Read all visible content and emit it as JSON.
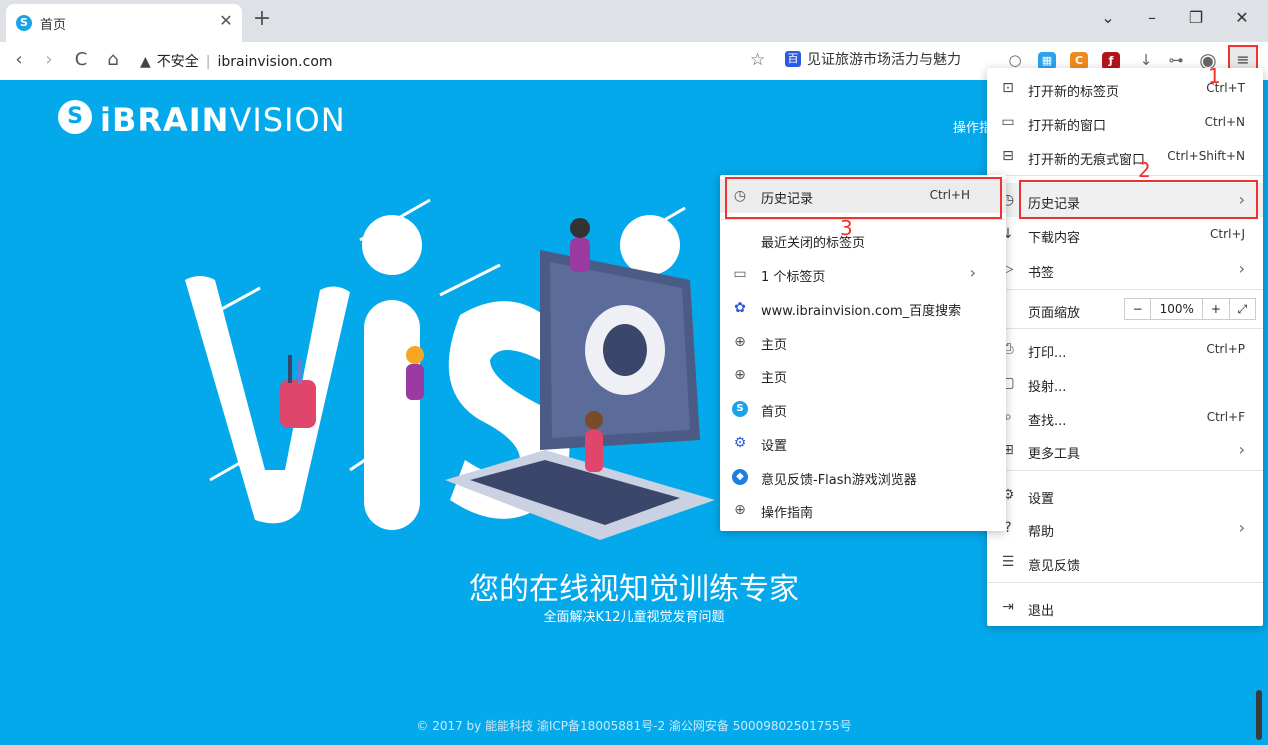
{
  "tab": {
    "title": "首页",
    "favicon": "S"
  },
  "window": {
    "minimize": "–",
    "restore": "❐",
    "close": "✕",
    "dropdown": "⌄",
    "new_tab": "+"
  },
  "toolbar": {
    "back": "‹",
    "forward": "›",
    "reload": "C",
    "home": "⌂",
    "security_label": "不安全",
    "url": "ibrainvision.com",
    "search_text": "见证旅游市场活力与魅力",
    "menu_icon": "≡"
  },
  "page": {
    "logo_bold": "iBRAIN",
    "logo_light": "VISION",
    "nav_link": "操作指",
    "hero_title": "您的在线视知觉训练专家",
    "hero_subtitle": "全面解决K12儿童视觉发育问题",
    "footer": "© 2017 by 能能科技 渝ICP备18005881号-2 渝公网安备 50009802501755号"
  },
  "main_menu": {
    "items": [
      {
        "label": "打开新的标签页",
        "shortcut": "Ctrl+T"
      },
      {
        "label": "打开新的窗口",
        "shortcut": "Ctrl+N"
      },
      {
        "label": "打开新的无痕式窗口",
        "shortcut": "Ctrl+Shift+N"
      },
      {
        "label": "历史记录",
        "shortcut": ""
      },
      {
        "label": "下载内容",
        "shortcut": "Ctrl+J"
      },
      {
        "label": "书签",
        "shortcut": ""
      },
      {
        "label": "页面缩放",
        "shortcut": ""
      },
      {
        "label": "打印...",
        "shortcut": "Ctrl+P"
      },
      {
        "label": "投射...",
        "shortcut": ""
      },
      {
        "label": "查找...",
        "shortcut": "Ctrl+F"
      },
      {
        "label": "更多工具",
        "shortcut": ""
      },
      {
        "label": "设置",
        "shortcut": ""
      },
      {
        "label": "帮助",
        "shortcut": ""
      },
      {
        "label": "意见反馈",
        "shortcut": ""
      },
      {
        "label": "退出",
        "shortcut": ""
      }
    ],
    "zoom": {
      "minus": "−",
      "value": "100%",
      "plus": "+",
      "fullscreen": "⤢"
    }
  },
  "history_menu": {
    "items": [
      {
        "label": "历史记录",
        "shortcut": "Ctrl+H"
      },
      {
        "label": "最近关闭的标签页",
        "shortcut": ""
      },
      {
        "label": "1 个标签页",
        "shortcut": ""
      },
      {
        "label": "www.ibrainvision.com_百度搜索",
        "shortcut": ""
      },
      {
        "label": "主页",
        "shortcut": ""
      },
      {
        "label": "主页",
        "shortcut": ""
      },
      {
        "label": "首页",
        "shortcut": ""
      },
      {
        "label": "设置",
        "shortcut": ""
      },
      {
        "label": "意见反馈-Flash游戏浏览器",
        "shortcut": ""
      },
      {
        "label": "操作指南",
        "shortcut": ""
      }
    ]
  },
  "annotations": {
    "step1": "1",
    "step2": "2",
    "step3": "3"
  },
  "colors": {
    "page_bg": "#04a9ec",
    "highlight": "#e33333"
  }
}
